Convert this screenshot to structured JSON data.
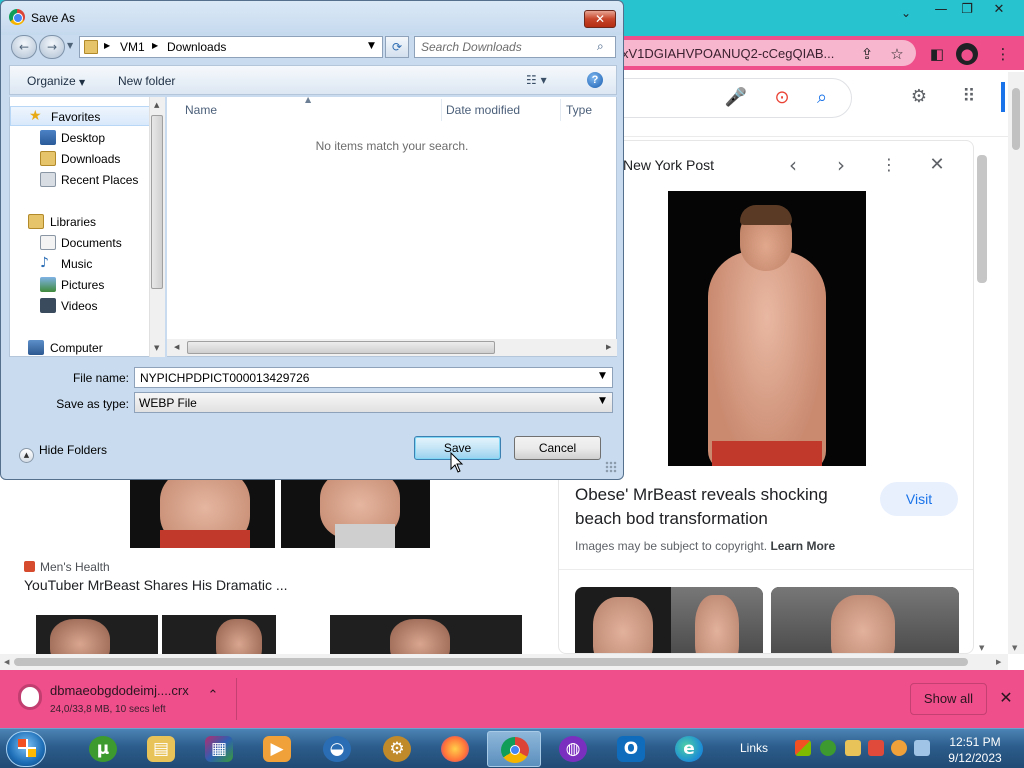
{
  "browser": {
    "address_text": "xV1DGIAHVPOANUQ2-cCegQIAB...",
    "preview": {
      "source": "New York Post",
      "title": "Obese' MrBeast reveals shocking beach bod transformation",
      "visit_label": "Visit",
      "copyright_text": "Images may be subject to copyright.",
      "learn_more_label": "Learn More"
    },
    "result": {
      "source": "Men's Health",
      "title": "YouTuber MrBeast Shares His Dramatic ..."
    }
  },
  "downloads": {
    "file_name": "dbmaeobgdodeimj....crx",
    "status": "24,0/33,8 MB, 10 secs left",
    "show_all_label": "Show all"
  },
  "taskbar": {
    "links_label": "Links",
    "time": "12:51 PM",
    "date": "9/12/2023"
  },
  "dialog": {
    "title": "Save As",
    "breadcrumb": [
      "VM1",
      "Downloads"
    ],
    "search_placeholder": "Search Downloads",
    "organize_label": "Organize",
    "new_folder_label": "New folder",
    "nav": {
      "favorites": "Favorites",
      "desktop": "Desktop",
      "downloads": "Downloads",
      "recent_places": "Recent Places",
      "libraries": "Libraries",
      "documents": "Documents",
      "music": "Music",
      "pictures": "Pictures",
      "videos": "Videos",
      "computer": "Computer"
    },
    "columns": [
      "Name",
      "Date modified",
      "Type"
    ],
    "empty_message": "No items match your search.",
    "file_name_label": "File name:",
    "file_name_value": "NYPICHPDPICT000013429726",
    "save_as_type_label": "Save as type:",
    "save_as_type_value": "WEBP File",
    "hide_folders_label": "Hide Folders",
    "save_label": "Save",
    "cancel_label": "Cancel"
  },
  "colors": {
    "browser_tab_strip": "#27c4d0",
    "browser_toolbar": "#ef4f8a",
    "accent_blue": "#1a73e8"
  }
}
